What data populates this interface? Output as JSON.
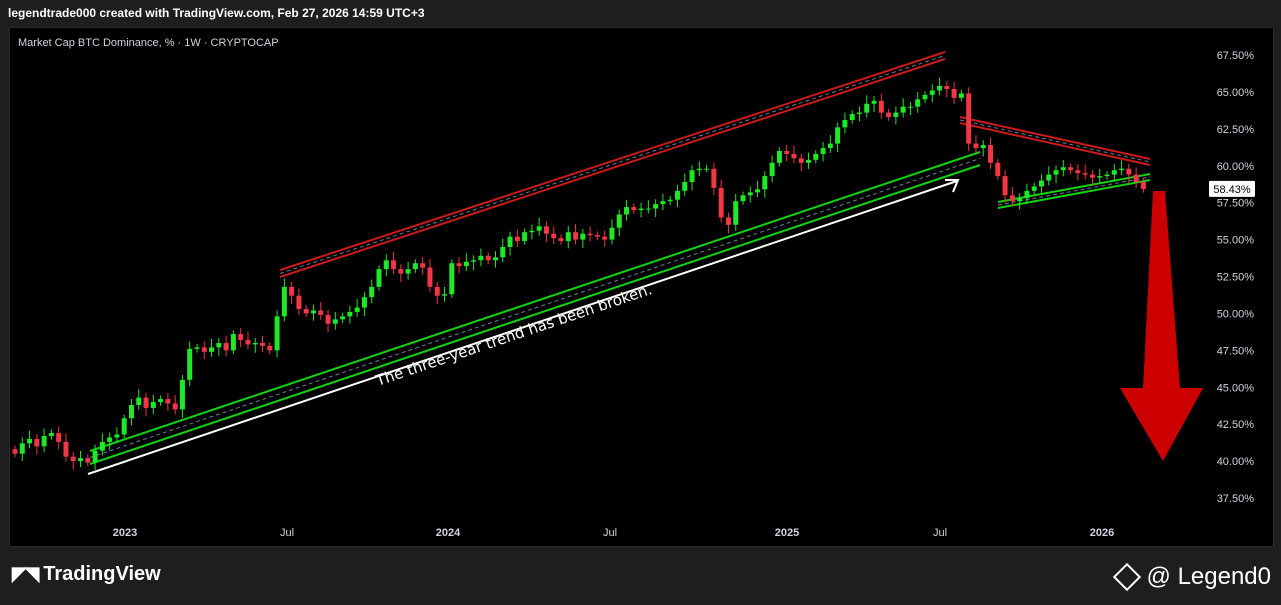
{
  "header": {
    "text": "legendtrade000 created with TradingView.com, Feb 27, 2026 14:59 UTC+3"
  },
  "footer": {
    "brand": "TradingView",
    "brand_icon": "tradingview-logo-icon",
    "author": "@ Legend0"
  },
  "chart_data": {
    "type": "candlestick",
    "title": "Market Cap BTC Dominance, % · 1W · CRYPTOCAP",
    "y_ticks": [
      "67.50%",
      "65.00%",
      "62.50%",
      "60.00%",
      "57.50%",
      "55.00%",
      "52.50%",
      "50.00%",
      "47.50%",
      "45.00%",
      "42.50%",
      "40.00%",
      "37.50%"
    ],
    "x_ticks": [
      "2023",
      "Jul",
      "2024",
      "Jul",
      "2025",
      "Jul",
      "2026"
    ],
    "ylim": [
      36.0,
      68.5
    ],
    "last_price_label": "58.43%",
    "last_price": 58.43,
    "annotation": "The three-year trend has been broken.",
    "colors": {
      "up": "#1ee827",
      "down": "#f23645",
      "channel_up": "#12d212",
      "channel_down": "#cc1a1a",
      "arrow": "#cc0000"
    },
    "closes": [
      40.5,
      41.2,
      41.5,
      41.0,
      41.7,
      41.9,
      41.3,
      40.3,
      40.0,
      40.2,
      39.9,
      40.7,
      41.3,
      41.6,
      41.8,
      42.9,
      43.8,
      44.3,
      43.6,
      44.0,
      44.2,
      43.9,
      43.5,
      45.5,
      47.6,
      47.7,
      47.4,
      47.7,
      48.0,
      47.5,
      48.6,
      48.2,
      47.9,
      48.0,
      47.8,
      47.5,
      49.8,
      51.8,
      51.2,
      50.3,
      50.0,
      50.2,
      49.9,
      49.3,
      49.6,
      49.8,
      50.1,
      50.4,
      51.1,
      51.8,
      53.0,
      53.6,
      53.0,
      52.7,
      53.0,
      53.4,
      53.1,
      51.8,
      51.2,
      51.3,
      53.4,
      53.2,
      53.5,
      53.6,
      53.9,
      53.6,
      53.8,
      54.5,
      55.2,
      54.9,
      55.5,
      55.6,
      55.9,
      55.4,
      55.1,
      54.9,
      55.5,
      55.0,
      55.4,
      55.3,
      55.2,
      55.0,
      55.8,
      56.7,
      57.2,
      57.0,
      57.1,
      57.1,
      57.4,
      57.6,
      57.7,
      58.3,
      58.9,
      59.7,
      59.8,
      59.8,
      58.5,
      56.5,
      56.0,
      57.6,
      58.0,
      58.2,
      58.4,
      59.3,
      60.2,
      61.0,
      60.8,
      60.5,
      60.2,
      60.4,
      60.8,
      61.2,
      61.5,
      62.6,
      63.1,
      63.5,
      63.6,
      64.2,
      64.4,
      63.6,
      63.3,
      63.6,
      64.0,
      64.0,
      64.5,
      64.8,
      65.1,
      65.4,
      65.2,
      64.6,
      64.9,
      61.5,
      61.2,
      61.4,
      60.2,
      59.3,
      58.0,
      57.6,
      57.8,
      58.3,
      58.6,
      59.0,
      59.4,
      59.7,
      59.9,
      59.7,
      59.5,
      59.4,
      59.2,
      59.3,
      59.4,
      59.7,
      59.8,
      59.4,
      58.9,
      58.43
    ],
    "channels": {
      "ascending_support": {
        "from": {
          "date": "2022-12",
          "price": 40.9
        },
        "to": {
          "date": "2025-07",
          "price": 60.8
        }
      },
      "ascending_resistance": {
        "from": {
          "date": "2023-06",
          "price": 52.5
        },
        "to": {
          "date": "2025-07",
          "price": 67.5
        }
      },
      "triangle_resistance": {
        "from": {
          "date": "2025-07",
          "price": 62.9
        },
        "to": {
          "date": "2026-02",
          "price": 60.0
        }
      },
      "triangle_support": {
        "from": {
          "date": "2025-08",
          "price": 57.0
        },
        "to": {
          "date": "2026-02",
          "price": 58.9
        }
      }
    }
  }
}
